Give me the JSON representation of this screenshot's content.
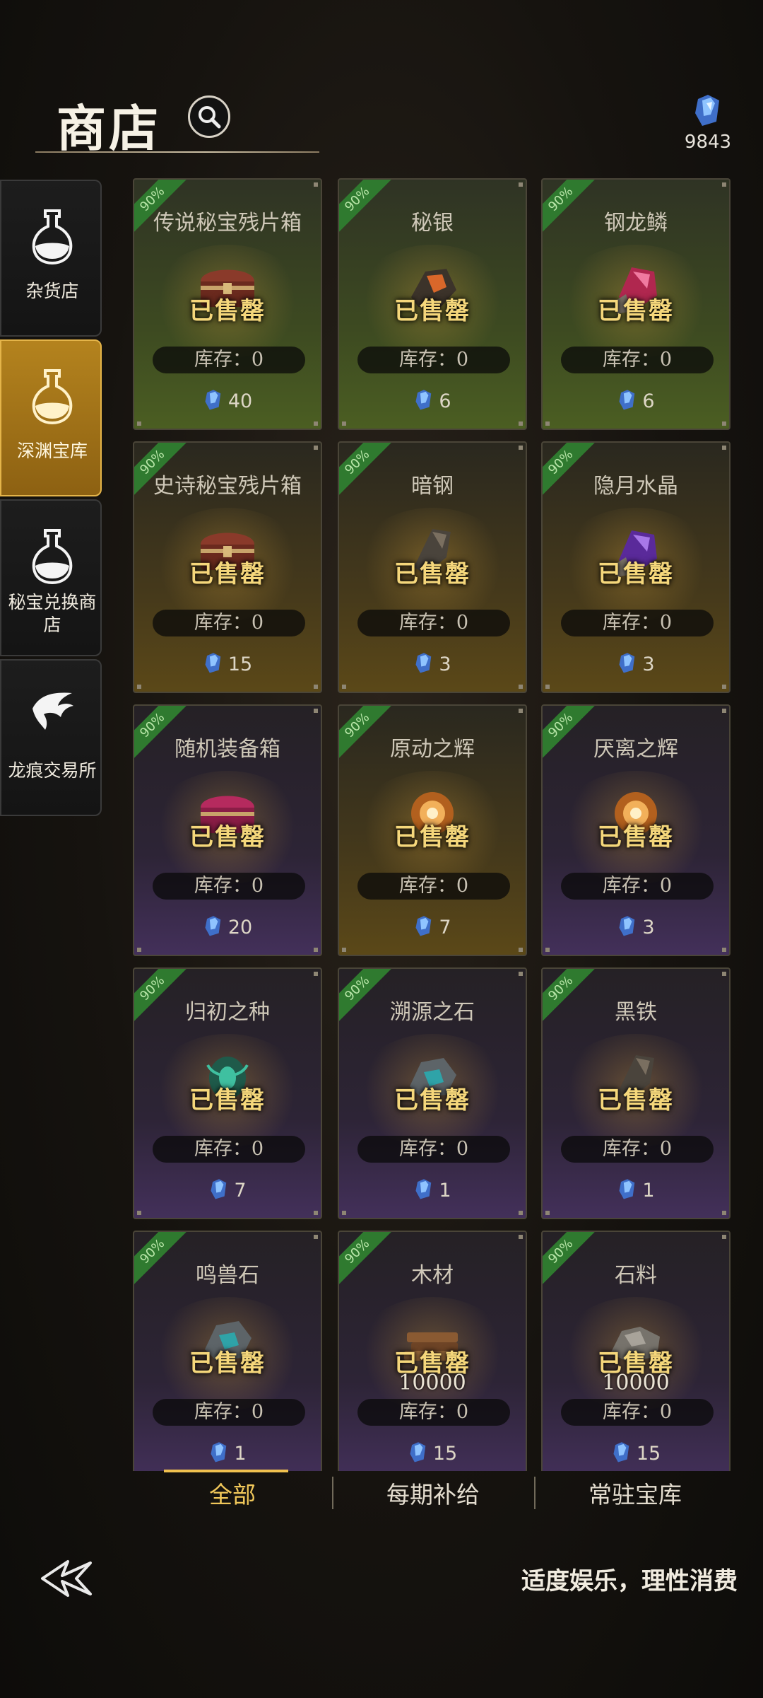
{
  "header": {
    "title": "商店",
    "currency_amount": "9843"
  },
  "sidebar": {
    "items": [
      {
        "label": "杂货店",
        "active": false
      },
      {
        "label": "深渊宝库",
        "active": true
      },
      {
        "label": "秘宝兑换商店",
        "active": false
      },
      {
        "label": "龙痕交易所",
        "active": false
      }
    ]
  },
  "shop": {
    "discount_badge": "90%",
    "sold_label": "已售罄",
    "items": [
      {
        "name": "传说秘宝残片箱",
        "stock": "库存：0",
        "price": "40",
        "theme": "green",
        "art": "chest-red"
      },
      {
        "name": "秘银",
        "stock": "库存：0",
        "price": "6",
        "theme": "green",
        "art": "ore-orange"
      },
      {
        "name": "钢龙鳞",
        "stock": "库存：0",
        "price": "6",
        "theme": "green",
        "art": "crystal-pink"
      },
      {
        "name": "史诗秘宝残片箱",
        "stock": "库存：0",
        "price": "15",
        "theme": "gold",
        "art": "chest-red"
      },
      {
        "name": "暗钢",
        "stock": "库存：0",
        "price": "3",
        "theme": "gold",
        "art": "ore-dark"
      },
      {
        "name": "隐月水晶",
        "stock": "库存：0",
        "price": "3",
        "theme": "gold",
        "art": "crystal-purple"
      },
      {
        "name": "随机装备箱",
        "stock": "库存：0",
        "price": "20",
        "theme": "purple",
        "art": "chest-pink"
      },
      {
        "name": "原动之辉",
        "stock": "库存：0",
        "price": "7",
        "theme": "gold",
        "art": "orb-orange"
      },
      {
        "name": "厌离之辉",
        "stock": "库存：0",
        "price": "3",
        "theme": "purple",
        "art": "orb-orange"
      },
      {
        "name": "归初之种",
        "stock": "库存：0",
        "price": "7",
        "theme": "purple",
        "art": "seed-green"
      },
      {
        "name": "溯源之石",
        "stock": "库存：0",
        "price": "1",
        "theme": "purple",
        "art": "stone-teal"
      },
      {
        "name": "黑铁",
        "stock": "库存：0",
        "price": "1",
        "theme": "purple",
        "art": "ore-dark"
      },
      {
        "name": "鸣兽石",
        "stock": "库存：0",
        "price": "1",
        "theme": "purple",
        "art": "stone-teal"
      },
      {
        "name": "木材",
        "quantity": "10000",
        "stock": "库存：0",
        "price": "15",
        "theme": "purple",
        "art": "wood"
      },
      {
        "name": "石料",
        "quantity": "10000",
        "stock": "库存：0",
        "price": "15",
        "theme": "purple",
        "art": "stone-grey"
      }
    ]
  },
  "tabs": [
    {
      "label": "全部",
      "active": true
    },
    {
      "label": "每期补给",
      "active": false
    },
    {
      "label": "常驻宝库",
      "active": false
    }
  ],
  "footer": {
    "notice": "适度娱乐，理性消费"
  },
  "colors": {
    "accent": "#f0c14f",
    "sold": "#f5d77b",
    "discount": "#2f7a2f"
  }
}
